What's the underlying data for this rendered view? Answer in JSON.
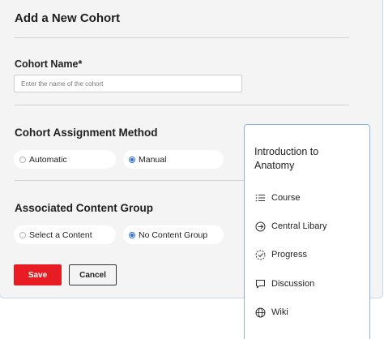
{
  "form": {
    "title": "Add a New Cohort",
    "cohort_name": {
      "label": "Cohort Name*",
      "placeholder": "Enter the name of the cohort",
      "value": ""
    },
    "assignment_method": {
      "title": "Cohort Assignment Method",
      "options": [
        {
          "label": "Automatic",
          "selected": false
        },
        {
          "label": "Manual",
          "selected": true
        }
      ]
    },
    "content_group": {
      "title": "Associated Content Group",
      "options": [
        {
          "label": "Select a Content",
          "selected": false
        },
        {
          "label": "No Content Group",
          "selected": true
        }
      ]
    },
    "buttons": {
      "save": "Save",
      "cancel": "Cancel"
    }
  },
  "course_menu": {
    "title": "Introduction to Anatomy",
    "items": [
      {
        "label": "Course",
        "icon": "list-icon"
      },
      {
        "label": "Central Libary",
        "icon": "arrow-circle-icon"
      },
      {
        "label": "Progress",
        "icon": "progress-icon"
      },
      {
        "label": "Discussion",
        "icon": "chat-icon"
      },
      {
        "label": "Wiki",
        "icon": "globe-icon"
      }
    ]
  },
  "colors": {
    "save_button": "#e81c23",
    "radio_selected": "#2b6de2",
    "panel_border": "#8fb1ea",
    "card_background": "#f4f4f4"
  }
}
